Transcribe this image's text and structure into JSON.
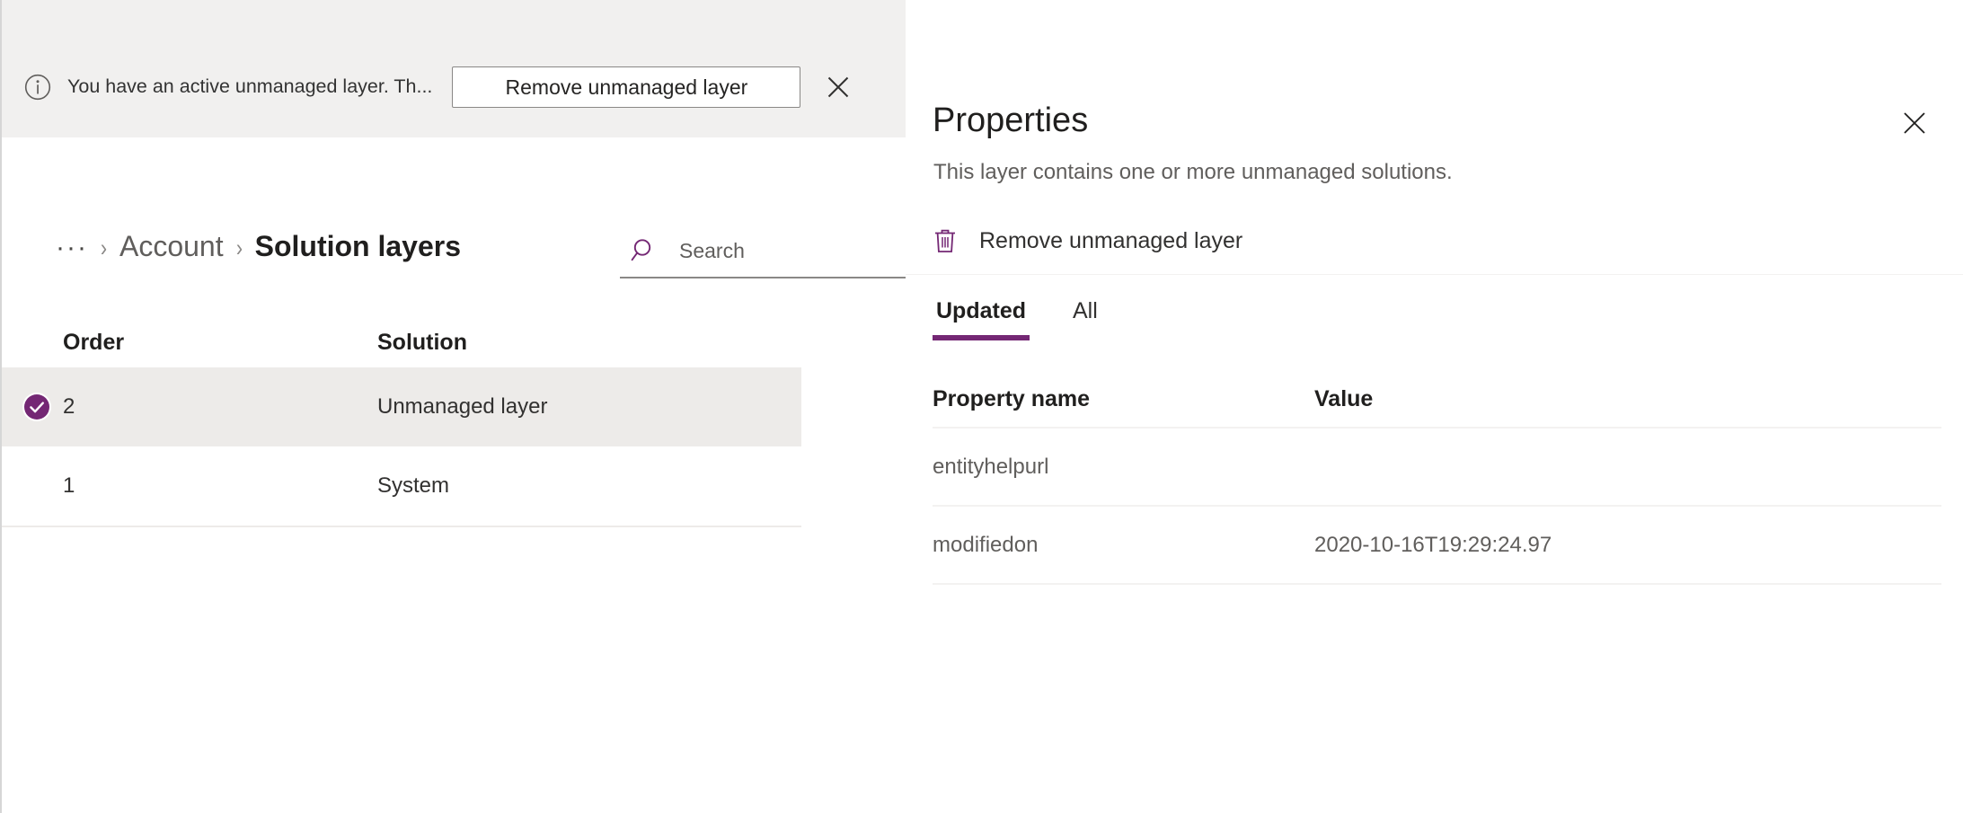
{
  "notification": {
    "icon": "info-icon",
    "message": "You have an active unmanaged layer. Th...",
    "action_label": "Remove unmanaged layer",
    "close_icon": "close-icon"
  },
  "breadcrumb": {
    "overflow": "···",
    "separator": "›",
    "parent": "Account",
    "current": "Solution layers"
  },
  "search": {
    "icon": "search-icon",
    "placeholder": "Search",
    "value": ""
  },
  "layers_table": {
    "columns": [
      "Order",
      "Solution"
    ],
    "rows": [
      {
        "order": "2",
        "solution": "Unmanaged layer",
        "selected": true
      },
      {
        "order": "1",
        "solution": "System",
        "selected": false
      }
    ]
  },
  "panel": {
    "title": "Properties",
    "subtitle": "This layer contains one or more unmanaged solutions.",
    "close_icon": "close-icon",
    "command": {
      "icon": "trash-icon",
      "label": "Remove unmanaged layer"
    },
    "tabs": [
      {
        "label": "Updated",
        "active": true
      },
      {
        "label": "All",
        "active": false
      }
    ],
    "properties_table": {
      "columns": [
        "Property name",
        "Value"
      ],
      "rows": [
        {
          "name": "entityhelpurl",
          "value": ""
        },
        {
          "name": "modifiedon",
          "value": "2020-10-16T19:29:24.97"
        }
      ]
    }
  },
  "colors": {
    "accent_purple": "#742774",
    "bar_background": "#f1f0ef",
    "selected_row": "#edebe9",
    "divider": "#f3f2f1"
  }
}
